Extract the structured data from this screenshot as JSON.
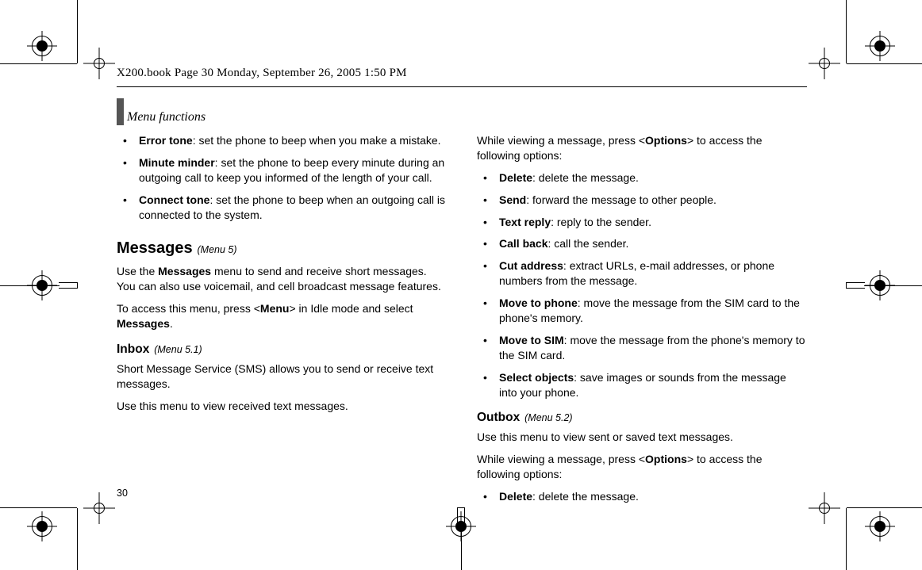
{
  "book_header": "X200.book  Page 30  Monday, September 26, 2005  1:50 PM",
  "section_title": "Menu functions",
  "page_number": "30",
  "left": {
    "bullets_top": [
      {
        "term": "Error tone",
        "desc": ": set the phone to beep when you make a mistake."
      },
      {
        "term": "Minute minder",
        "desc": ": set the phone to beep every minute during an outgoing call to keep you informed of the length of your call."
      },
      {
        "term": "Connect tone",
        "desc": ": set the phone to beep when an outgoing call is connected to the system."
      }
    ],
    "h1": "Messages",
    "h1_note": "(Menu 5)",
    "p1a": "Use the ",
    "p1b": "Messages",
    "p1c": " menu to send and receive short messages. You can also use voicemail, and cell broadcast message features.",
    "p2a": "To access this menu, press <",
    "p2b": "Menu",
    "p2c": "> in Idle mode and select ",
    "p2d": "Messages",
    "p2e": ".",
    "h2": "Inbox",
    "h2_note": "(Menu 5.1)",
    "p3": "Short Message Service (SMS) allows you to send or receive text messages.",
    "p4": "Use this menu to view received text messages."
  },
  "right": {
    "p1a": "While viewing a message, press <",
    "p1b": "Options",
    "p1c": "> to access the following options:",
    "bullets": [
      {
        "term": "Delete",
        "desc": ": delete the message."
      },
      {
        "term": "Send",
        "desc": ": forward the message to other people."
      },
      {
        "term": "Text reply",
        "desc": ": reply to the sender."
      },
      {
        "term": "Call back",
        "desc": ": call the sender."
      },
      {
        "term": "Cut address",
        "desc": ": extract URLs, e-mail addresses, or phone numbers from the message."
      },
      {
        "term": "Move to phone",
        "desc": ": move the message from the SIM card to the phone's memory."
      },
      {
        "term": "Move to SIM",
        "desc": ": move the message from the phone's memory to the SIM card."
      },
      {
        "term": "Select objects",
        "desc": ": save images or sounds from the message into your phone."
      }
    ],
    "h2": "Outbox",
    "h2_note": "(Menu 5.2)",
    "p2": "Use this menu to view sent or saved text messages.",
    "p3a": "While viewing a message, press <",
    "p3b": "Options",
    "p3c": "> to access the following options:",
    "bullets2": [
      {
        "term": "Delete",
        "desc": ": delete the message."
      }
    ]
  }
}
